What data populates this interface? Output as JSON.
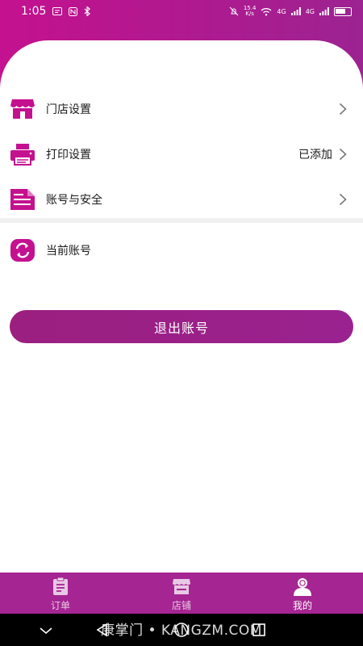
{
  "status_bar": {
    "time": "1:05",
    "net_speed_top": "15.4",
    "net_speed_bottom": "K/s",
    "signal_tag_1": "4G",
    "signal_tag_2": "4G"
  },
  "menu": {
    "store_settings": {
      "label": "门店设置",
      "icon": "storefront-icon"
    },
    "print_settings": {
      "label": "打印设置",
      "value": "已添加",
      "icon": "printer-icon"
    },
    "account_security": {
      "label": "账号与安全",
      "icon": "document-icon"
    },
    "current_account": {
      "label": "当前账号",
      "icon": "switch-account-icon"
    }
  },
  "logout": {
    "label": "退出账号"
  },
  "tabs": [
    {
      "label": "订单",
      "icon": "clipboard-icon",
      "active": false
    },
    {
      "label": "店铺",
      "icon": "shop-icon",
      "active": false
    },
    {
      "label": "我的",
      "icon": "user-icon",
      "active": true
    }
  ],
  "watermark": "康掌门 • KANGZM.COM",
  "colors": {
    "brand": "#c4118f",
    "brand_dark": "#9a2290",
    "tabbar": "#a52592",
    "divider": "#f0f0f0"
  }
}
